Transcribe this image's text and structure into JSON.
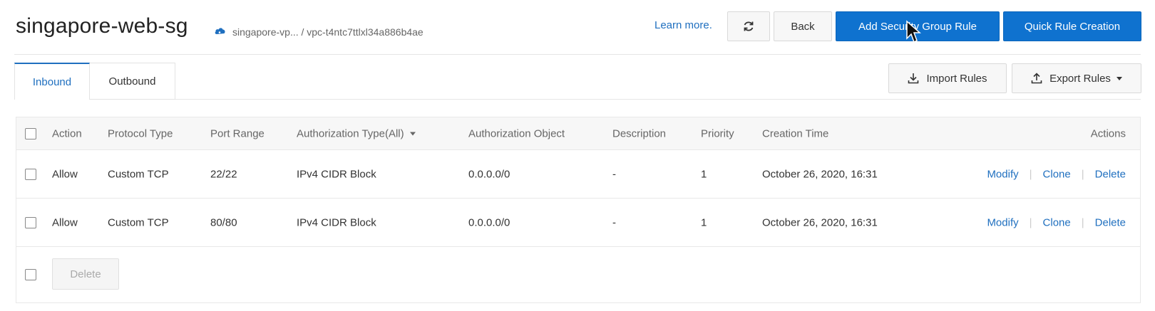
{
  "header": {
    "title": "singapore-web-sg",
    "breadcrumb": "singapore-vp... / vpc-t4ntc7ttlxl34a886b4ae",
    "learn_more": "Learn more.",
    "back_label": "Back",
    "add_rule_label": "Add Security Group Rule",
    "quick_rule_label": "Quick Rule Creation"
  },
  "tabs": [
    {
      "label": "Inbound",
      "active": true
    },
    {
      "label": "Outbound",
      "active": false
    }
  ],
  "toolbar": {
    "import_label": "Import Rules",
    "export_label": "Export Rules"
  },
  "table": {
    "columns": [
      "Action",
      "Protocol Type",
      "Port Range",
      "Authorization Type(All)",
      "Authorization Object",
      "Description",
      "Priority",
      "Creation Time",
      "Actions"
    ],
    "rows": [
      {
        "action": "Allow",
        "protocol": "Custom TCP",
        "port": "22/22",
        "auth_type": "IPv4 CIDR Block",
        "auth_object": "0.0.0.0/0",
        "description": "-",
        "priority": "1",
        "created": "October 26, 2020, 16:31",
        "modify": "Modify",
        "clone": "Clone",
        "delete": "Delete"
      },
      {
        "action": "Allow",
        "protocol": "Custom TCP",
        "port": "80/80",
        "auth_type": "IPv4 CIDR Block",
        "auth_object": "0.0.0.0/0",
        "description": "-",
        "priority": "1",
        "created": "October 26, 2020, 16:31",
        "modify": "Modify",
        "clone": "Clone",
        "delete": "Delete"
      }
    ],
    "footer_delete_label": "Delete"
  },
  "colors": {
    "primary": "#0f72cf",
    "link": "#1f6fbf"
  }
}
